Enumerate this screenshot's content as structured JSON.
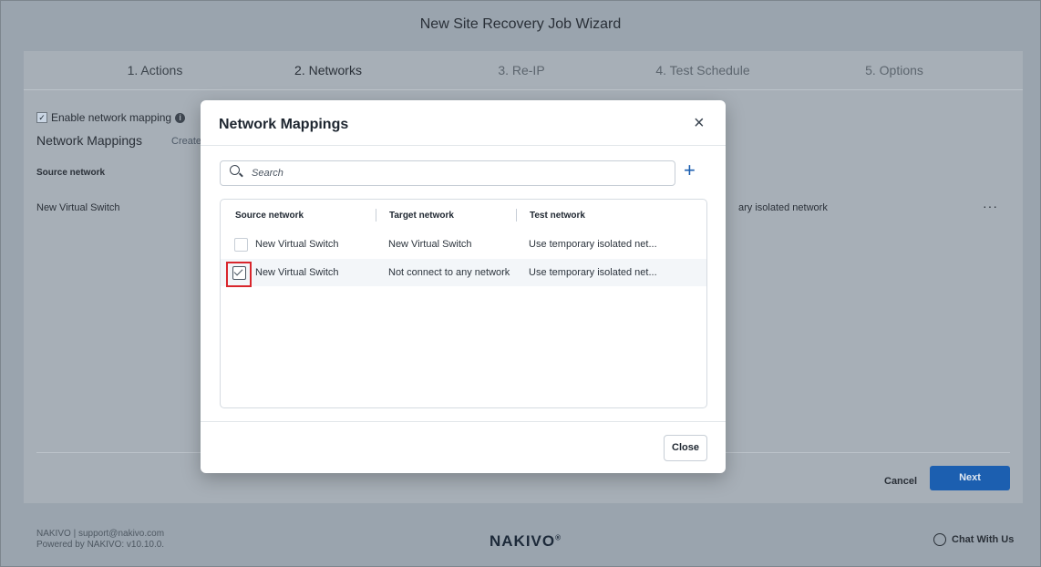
{
  "window": {
    "title": "New Site Recovery Job Wizard"
  },
  "steps": [
    "1. Actions",
    "2. Networks",
    "3. Re-IP",
    "4. Test Schedule",
    "5. Options"
  ],
  "background": {
    "enable_mapping_label": "Enable network mapping",
    "enable_mapping_checked": true,
    "section_title": "Network Mappings",
    "create_link": "Create",
    "column_source": "Source network",
    "row_source": "New Virtual Switch",
    "row_test": "ary isolated network",
    "more_icon": "more-horizontal-icon",
    "cancel_label": "Cancel",
    "next_label": "Next"
  },
  "modal": {
    "title": "Network Mappings",
    "search_placeholder": "Search",
    "columns": [
      "Source network",
      "Target network",
      "Test network"
    ],
    "rows": [
      {
        "checked": false,
        "source": "New Virtual Switch",
        "target": "New Virtual Switch",
        "test": "Use temporary isolated net..."
      },
      {
        "checked": true,
        "source": "New Virtual Switch",
        "target": "Not connect to any network",
        "test": "Use temporary isolated net..."
      }
    ],
    "close_label": "Close"
  },
  "footer": {
    "line1": "NAKIVO | support@nakivo.com",
    "line2": "Powered by NAKIVO: v10.10.0.",
    "logo": "NAKIVO",
    "chat_label": "Chat With Us"
  },
  "colors": {
    "accent": "#1c5fb0",
    "highlight_border": "#d9262c",
    "overlay": "#9aa4ae"
  }
}
